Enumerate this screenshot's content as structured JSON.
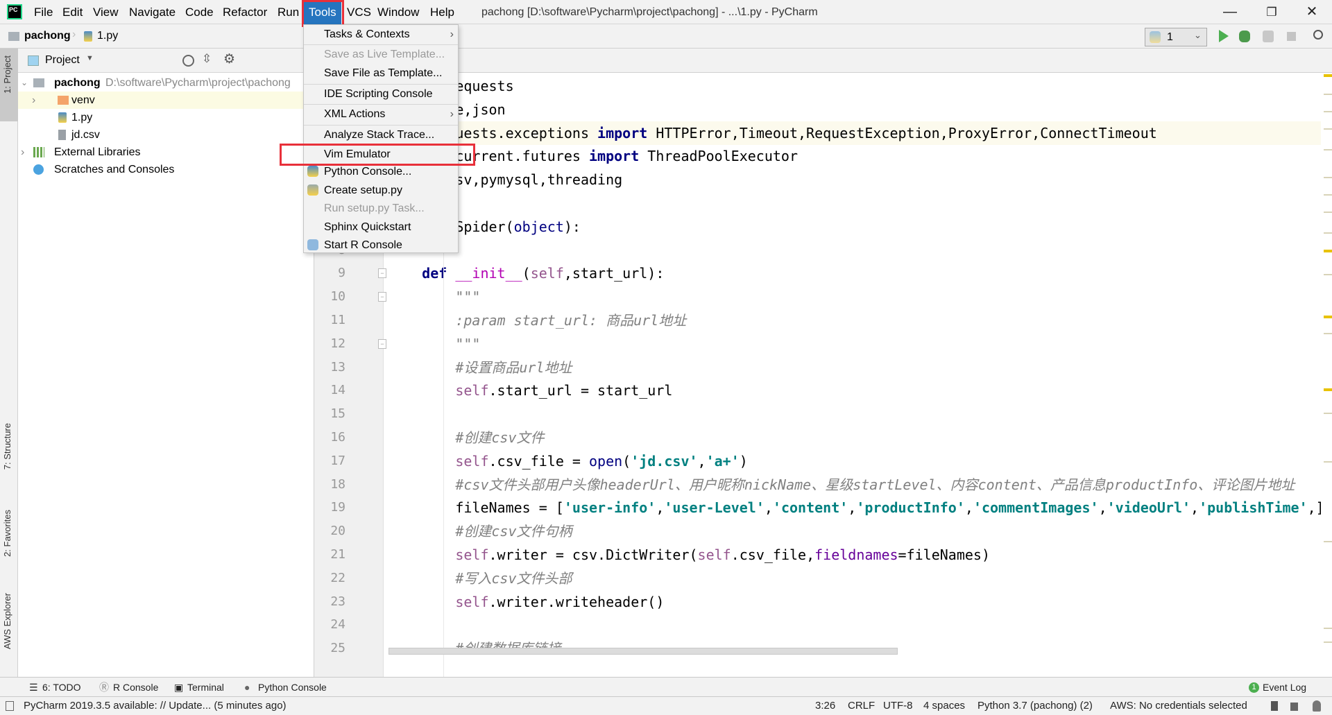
{
  "app": {
    "title": "pachong [D:\\software\\Pycharm\\project\\pachong] - ...\\1.py - PyCharm",
    "logo": "PC"
  },
  "menubar": [
    "File",
    "Edit",
    "View",
    "Navigate",
    "Code",
    "Refactor",
    "Run",
    "Tools",
    "VCS",
    "Window",
    "Help"
  ],
  "window_controls": {
    "minimize": "—",
    "restore": "❐",
    "close": "✕"
  },
  "breadcrumb": {
    "project": "pachong",
    "file": "1.py"
  },
  "toolbar": {
    "run_config": "1"
  },
  "left_stripe": [
    "1: Project",
    "7: Structure",
    "2: Favorites",
    "AWS Explorer"
  ],
  "project_panel": {
    "title": "Project",
    "tree": [
      {
        "label": "pachong",
        "path": "D:\\software\\Pycharm\\project\\pachong"
      },
      {
        "label": "venv"
      },
      {
        "label": "1.py"
      },
      {
        "label": "jd.csv"
      },
      {
        "label": "External Libraries"
      },
      {
        "label": "Scratches and Consoles"
      }
    ]
  },
  "tools_menu": [
    {
      "label": "Tasks & Contexts",
      "submenu": true
    },
    {
      "label": "Save as Live Template...",
      "disabled": true
    },
    {
      "label": "Save File as Template..."
    },
    {
      "label": "IDE Scripting Console"
    },
    {
      "label": "XML Actions",
      "submenu": true
    },
    {
      "label": "Analyze Stack Trace..."
    },
    {
      "label": "Vim Emulator"
    },
    {
      "label": "Python Console..."
    },
    {
      "label": "Create setup.py"
    },
    {
      "label": "Run setup.py Task...",
      "disabled": true
    },
    {
      "label": "Sphinx Quickstart"
    },
    {
      "label": "Start R Console"
    }
  ],
  "submenu_arrow": "›",
  "editor": {
    "current_line": 3,
    "lines": [
      [
        {
          "t": "        equests"
        }
      ],
      [
        {
          "t": "        e,json"
        }
      ],
      [
        {
          "t": "        uests.exceptions "
        },
        {
          "t": "import",
          "c": "kw"
        },
        {
          "t": " HTTPError,Timeout,RequestException,ProxyError,ConnectTimeout"
        }
      ],
      [
        {
          "t": "        current.futures "
        },
        {
          "t": "import",
          "c": "kw"
        },
        {
          "t": " ThreadPoolExecutor"
        }
      ],
      [
        {
          "t": "        sv,pymysql,threading"
        }
      ],
      [],
      [
        {
          "t": "        Spider("
        },
        {
          "t": "object",
          "c": "bi"
        },
        {
          "t": "):"
        }
      ],
      [],
      [
        {
          "t": "    "
        },
        {
          "t": "def",
          "c": "kw"
        },
        {
          "t": " "
        },
        {
          "t": "__init__",
          "c": "dun"
        },
        {
          "t": "("
        },
        {
          "t": "self",
          "c": "self"
        },
        {
          "t": ",start_url):"
        }
      ],
      [
        {
          "t": "        \"\"\"",
          "c": "cm"
        }
      ],
      [
        {
          "t": "        :param start_url: 商品url地址",
          "c": "cm"
        }
      ],
      [
        {
          "t": "        \"\"\"",
          "c": "cm"
        }
      ],
      [
        {
          "t": "        #设置商品url地址",
          "c": "cm"
        }
      ],
      [
        {
          "t": "        "
        },
        {
          "t": "self",
          "c": "self"
        },
        {
          "t": ".start_url = start_url"
        }
      ],
      [],
      [
        {
          "t": "        #创建csv文件",
          "c": "cm"
        }
      ],
      [
        {
          "t": "        "
        },
        {
          "t": "self",
          "c": "self"
        },
        {
          "t": ".csv_file = "
        },
        {
          "t": "open",
          "c": "bi"
        },
        {
          "t": "("
        },
        {
          "t": "'jd.csv'",
          "c": "str"
        },
        {
          "t": ","
        },
        {
          "t": "'a+'",
          "c": "str"
        },
        {
          "t": ")"
        }
      ],
      [
        {
          "t": "        #csv文件头部用户头像headerUrl、用户昵称nickName、星级startLevel、内容content、产品信息productInfo、评论图片地址",
          "c": "cm"
        }
      ],
      [
        {
          "t": "        fileNames = ["
        },
        {
          "t": "'user-info'",
          "c": "str"
        },
        {
          "t": ","
        },
        {
          "t": "'user-Level'",
          "c": "str"
        },
        {
          "t": ","
        },
        {
          "t": "'content'",
          "c": "str"
        },
        {
          "t": ","
        },
        {
          "t": "'productInfo'",
          "c": "str"
        },
        {
          "t": ","
        },
        {
          "t": "'commentImages'",
          "c": "str"
        },
        {
          "t": ","
        },
        {
          "t": "'videoUrl'",
          "c": "str"
        },
        {
          "t": ","
        },
        {
          "t": "'publishTime'",
          "c": "str"
        },
        {
          "t": ",]"
        }
      ],
      [
        {
          "t": "        #创建csv文件句柄",
          "c": "cm"
        }
      ],
      [
        {
          "t": "        "
        },
        {
          "t": "self",
          "c": "self"
        },
        {
          "t": ".writer = csv.DictWriter("
        },
        {
          "t": "self",
          "c": "self"
        },
        {
          "t": ".csv_file,"
        },
        {
          "t": "fieldnames",
          "c": "kwa"
        },
        {
          "t": "=fileNames)"
        }
      ],
      [
        {
          "t": "        #写入csv文件头部",
          "c": "cm"
        }
      ],
      [
        {
          "t": "        "
        },
        {
          "t": "self",
          "c": "self"
        },
        {
          "t": ".writer.writeheader()"
        }
      ],
      [],
      [
        {
          "t": "        #创建数据库链接",
          "c": "cm"
        }
      ]
    ]
  },
  "bottom_tools": {
    "todo": "6: TODO",
    "r_console": "R Console",
    "terminal": "Terminal",
    "python_console": "Python Console",
    "event_log": "Event Log",
    "event_count": "1"
  },
  "status": {
    "message": "PyCharm 2019.3.5 available: // Update... (5 minutes ago)",
    "position": "3:26",
    "line_sep": "CRLF",
    "encoding": "UTF-8",
    "indent": "4 spaces",
    "interpreter": "Python 3.7 (pachong) (2)",
    "aws": "AWS: No credentials selected"
  },
  "colors": {
    "accent": "#2675bf",
    "highlight_box": "#e8303a",
    "run": "#4caf50"
  }
}
